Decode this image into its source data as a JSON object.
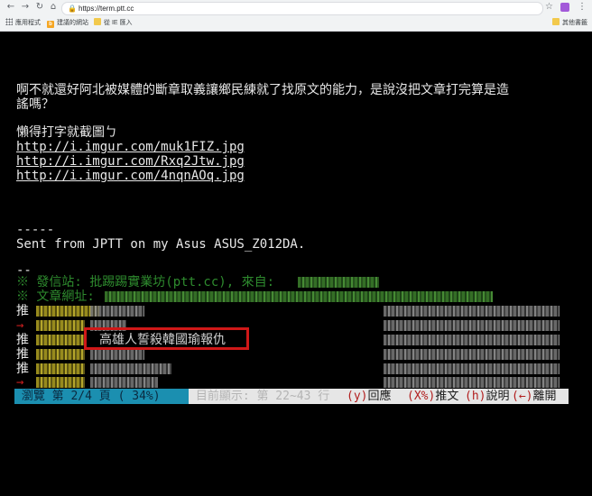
{
  "browser": {
    "url": "https://term.ptt.cc",
    "bookmarks": [
      {
        "label": "應用程式",
        "icon": "apps-icon"
      },
      {
        "label": "建議的網站",
        "icon": "bing-icon"
      },
      {
        "label": "從 IE 匯入",
        "icon": "folder-icon"
      },
      {
        "label": "其他書籤",
        "icon": "folder-icon"
      }
    ]
  },
  "terminal": {
    "lines": [
      "啊不就還好阿北被媒體的斷章取義讓鄉民練就了找原文的能力，是說沒把文章打完算是造",
      "謠嗎？",
      "懶得打字就截圖ㄅ",
      "http://i.imgur.com/muk1FIZ.jpg",
      "http://i.imgur.com/Rxq2Jtw.jpg",
      "http://i.imgur.com/4nqnAOq.jpg",
      "-----",
      "Sent from JPTT on my Asus ASUS_Z012DA.",
      "--",
      "※ 發信站: 批踢踢實業坊(ptt.cc), 來自:",
      "※ 文章網址:"
    ],
    "push_tags": [
      "推",
      "→",
      "推",
      "推",
      "推",
      "→"
    ],
    "highlight_comment": "高雄人誓殺韓國瑜報仇"
  },
  "statusbar": {
    "left": " 瀏覽 第 2/4 頁 ( 34%) ",
    "middle": " 目前顯示: 第 22~43 行 ",
    "keys": [
      {
        "key": "(y)",
        "label": "回應"
      },
      {
        "key": "(X%)",
        "label": "推文"
      },
      {
        "key": "(h)",
        "label": "說明"
      },
      {
        "key": "(←)",
        "label": "離開"
      }
    ]
  },
  "colors": {
    "terminal_bg": "#000000",
    "text": "#c0c0c0",
    "system_green": "#2e8b2e",
    "arrow_red": "#c81e1e",
    "status_cyan": "#1b8fb0",
    "highlight_red": "#d01818"
  }
}
